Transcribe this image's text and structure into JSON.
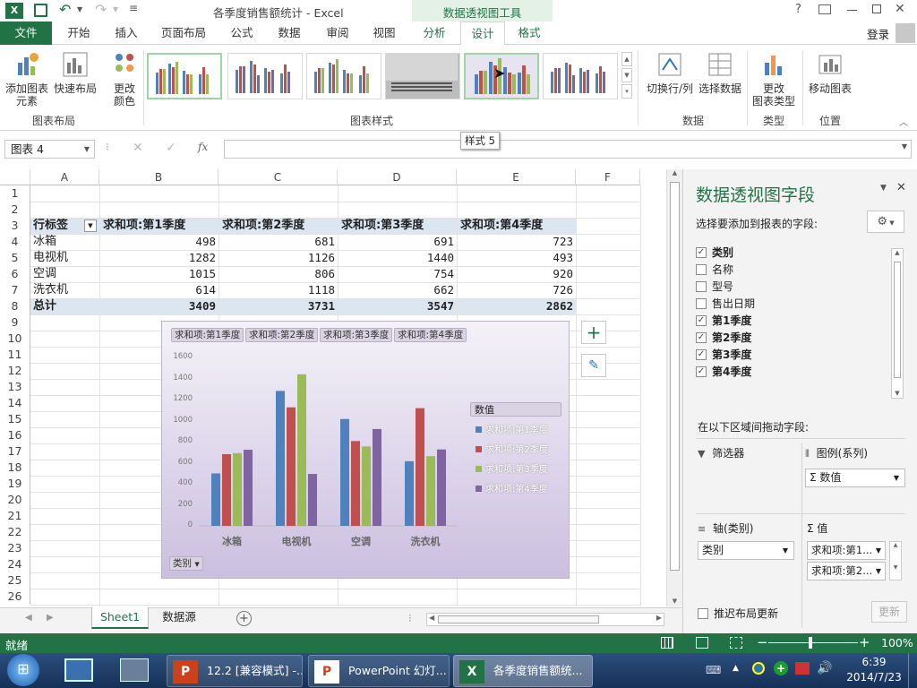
{
  "window": {
    "title": "各季度销售额统计 - Excel",
    "context_tools": "数据透视图工具",
    "help": "?",
    "sign_in": "登录"
  },
  "tabs": [
    {
      "label": "文件"
    },
    {
      "label": "开始"
    },
    {
      "label": "插入"
    },
    {
      "label": "页面布局"
    },
    {
      "label": "公式"
    },
    {
      "label": "数据"
    },
    {
      "label": "审阅"
    },
    {
      "label": "视图"
    },
    {
      "label": "分析"
    },
    {
      "label": "设计"
    },
    {
      "label": "格式"
    }
  ],
  "ribbon": {
    "add_element": "添加图表\n元素",
    "quick_layout": "快速布局",
    "change_colors": "更改\n颜色",
    "group_layout": "图表布局",
    "group_styles": "图表样式",
    "switch_row_col": "切换行/列",
    "select_data": "选择数据",
    "group_data": "数据",
    "change_type": "更改\n图表类型",
    "group_type": "类型",
    "move_chart": "移动图表",
    "group_location": "位置"
  },
  "tooltip": "样式 5",
  "namebox": "图表 4",
  "fx": "fx",
  "columns": [
    "A",
    "B",
    "C",
    "D",
    "E",
    "F"
  ],
  "rows": [
    "1",
    "2",
    "3",
    "4",
    "5",
    "6",
    "7",
    "8",
    "9",
    "10",
    "11",
    "12",
    "13",
    "14",
    "15",
    "16",
    "17",
    "18",
    "19",
    "20",
    "21",
    "22",
    "23",
    "24",
    "25",
    "26"
  ],
  "pivot": {
    "header": [
      "行标签",
      "求和项:第1季度",
      "求和项:第2季度",
      "求和项:第3季度",
      "求和项:第4季度"
    ],
    "data": [
      [
        "冰箱",
        "498",
        "681",
        "691",
        "723"
      ],
      [
        "电视机",
        "1282",
        "1126",
        "1440",
        "493"
      ],
      [
        "空调",
        "1015",
        "806",
        "754",
        "920"
      ],
      [
        "洗衣机",
        "614",
        "1118",
        "662",
        "726"
      ]
    ],
    "total": [
      "总计",
      "3409",
      "3731",
      "3547",
      "2862"
    ]
  },
  "chart_data": {
    "type": "bar",
    "categories": [
      "冰箱",
      "电视机",
      "空调",
      "洗衣机"
    ],
    "series": [
      {
        "name": "求和项:第1季度",
        "values": [
          498,
          1282,
          1015,
          614
        ],
        "color": "#4f81bd"
      },
      {
        "name": "求和项:第2季度",
        "values": [
          681,
          1126,
          806,
          1118
        ],
        "color": "#c0504d"
      },
      {
        "name": "求和项:第3季度",
        "values": [
          691,
          1440,
          754,
          662
        ],
        "color": "#9bbb59"
      },
      {
        "name": "求和项:第4季度",
        "values": [
          723,
          493,
          920,
          726
        ],
        "color": "#8064a2"
      }
    ],
    "yticks": [
      "0",
      "200",
      "400",
      "600",
      "800",
      "1000",
      "1200",
      "1400",
      "1600"
    ],
    "ylim": [
      0,
      1600
    ],
    "legend_title": "数值",
    "legend_position": "right",
    "filter_buttons": [
      "求和项:第1季度",
      "求和项:第2季度",
      "求和项:第3季度",
      "求和项:第4季度"
    ],
    "axis_field_button": "类别"
  },
  "panel": {
    "title": "数据透视图字段",
    "subtitle": "选择要添加到报表的字段:",
    "fields": [
      {
        "label": "类别",
        "checked": true
      },
      {
        "label": "名称",
        "checked": false
      },
      {
        "label": "型号",
        "checked": false
      },
      {
        "label": "售出日期",
        "checked": false
      },
      {
        "label": "第1季度",
        "checked": true
      },
      {
        "label": "第2季度",
        "checked": true
      },
      {
        "label": "第3季度",
        "checked": true
      },
      {
        "label": "第4季度",
        "checked": true
      }
    ],
    "drag_label": "在以下区域间拖动字段:",
    "filters": "筛选器",
    "legend_series": "图例(系列)",
    "legend_value": "Σ 数值",
    "axis_category": "轴(类别)",
    "axis_value": "类别",
    "values": "Σ 值",
    "value1": "求和项:第1...",
    "value2": "求和项:第2...",
    "defer": "推迟布局更新",
    "update": "更新"
  },
  "sheets": [
    "Sheet1",
    "数据源"
  ],
  "status": {
    "ready": "就绪",
    "zoom": "100%"
  },
  "taskbar": {
    "items": [
      "12.2 [兼容模式] -...",
      "PowerPoint 幻灯...",
      "各季度销售额统..."
    ],
    "time": "6:39",
    "date": "2014/7/23"
  }
}
